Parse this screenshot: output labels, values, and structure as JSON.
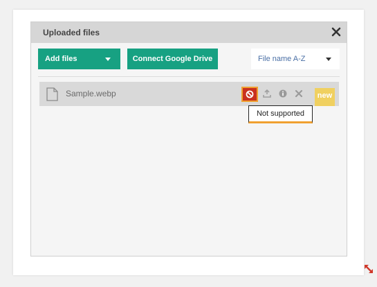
{
  "dialog": {
    "title": "Uploaded files",
    "close_icon": "close-icon"
  },
  "toolbar": {
    "add_files_label": "Add files",
    "google_drive_label": "Connect Google Drive",
    "sort_value": "File name A-Z"
  },
  "files": [
    {
      "name": "Sample.webp",
      "badge": "new",
      "tooltip": "Not supported"
    }
  ],
  "colors": {
    "accent": "#17a182",
    "error": "#c9301f",
    "highlight": "#f0a030",
    "badge": "#f0d060"
  }
}
